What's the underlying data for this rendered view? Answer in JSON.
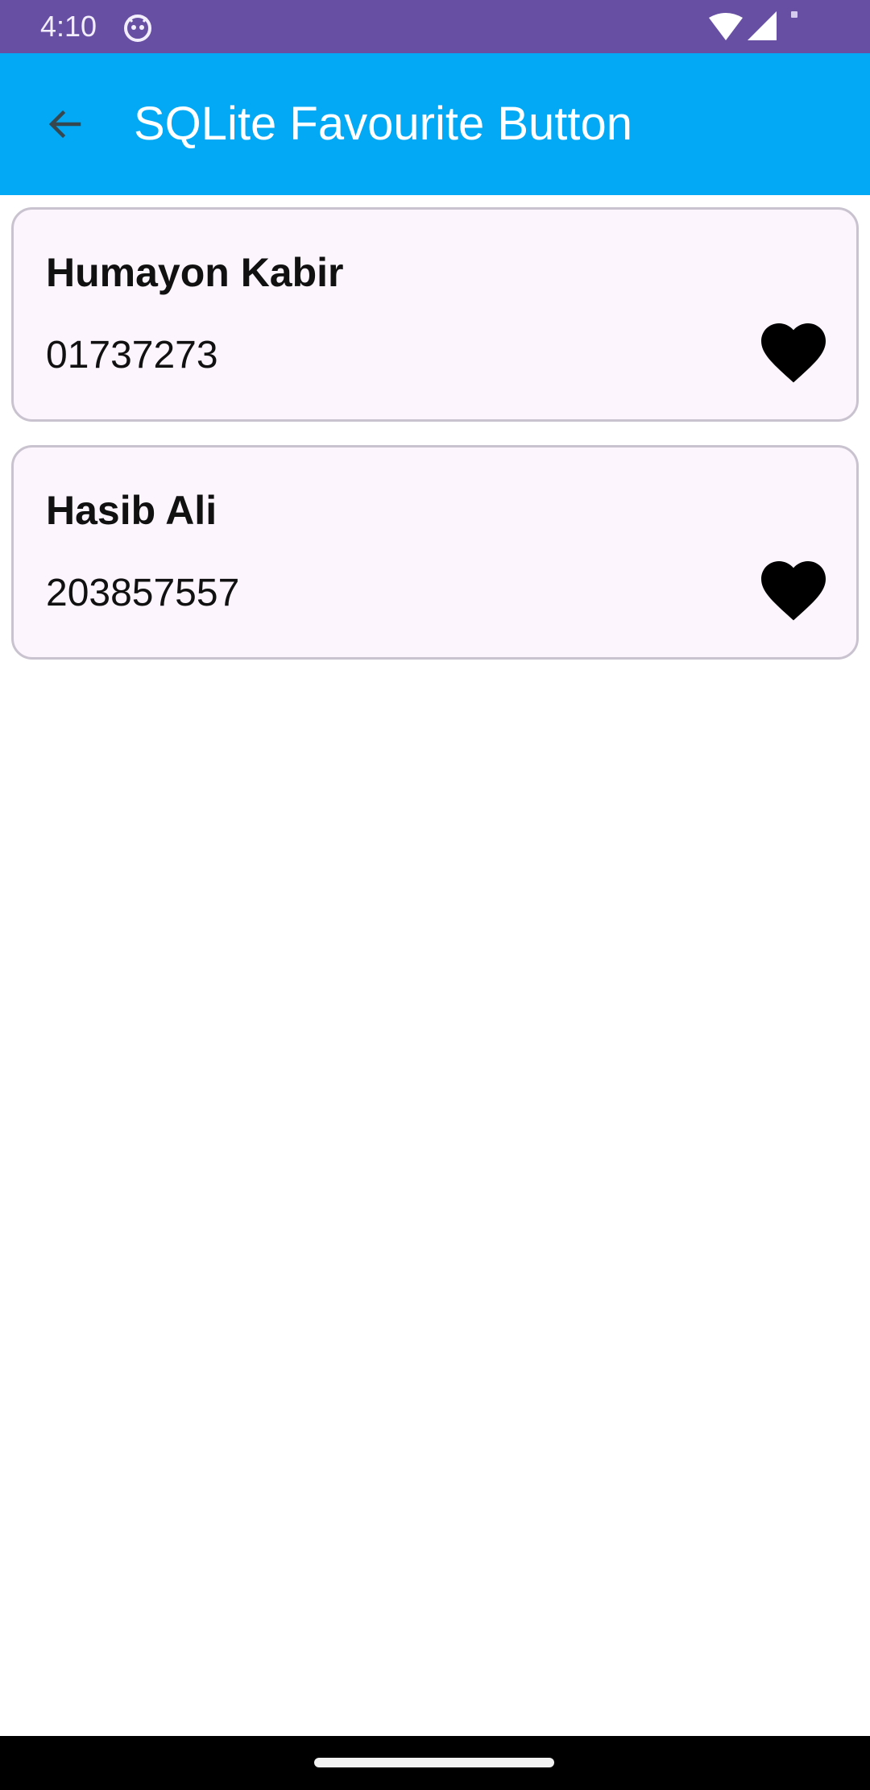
{
  "status_bar": {
    "time": "4:10",
    "icons": [
      "app-notification-icon",
      "wifi-icon",
      "signal-icon",
      "battery-icon"
    ],
    "background": "#6750A4"
  },
  "app_bar": {
    "title": "SQLite Favourite Button",
    "back_icon": "arrow-back-icon",
    "background": "#03A9F4"
  },
  "contacts": [
    {
      "name": "Humayon Kabir",
      "phone": "01737273",
      "favourite": true,
      "icon": "heart-filled-icon"
    },
    {
      "name": "Hasib Ali",
      "phone": "203857557",
      "favourite": true,
      "icon": "heart-filled-icon"
    }
  ],
  "colors": {
    "card_background": "#FCF5FD",
    "card_border": "#C9C2CF",
    "heart": "#000000"
  }
}
